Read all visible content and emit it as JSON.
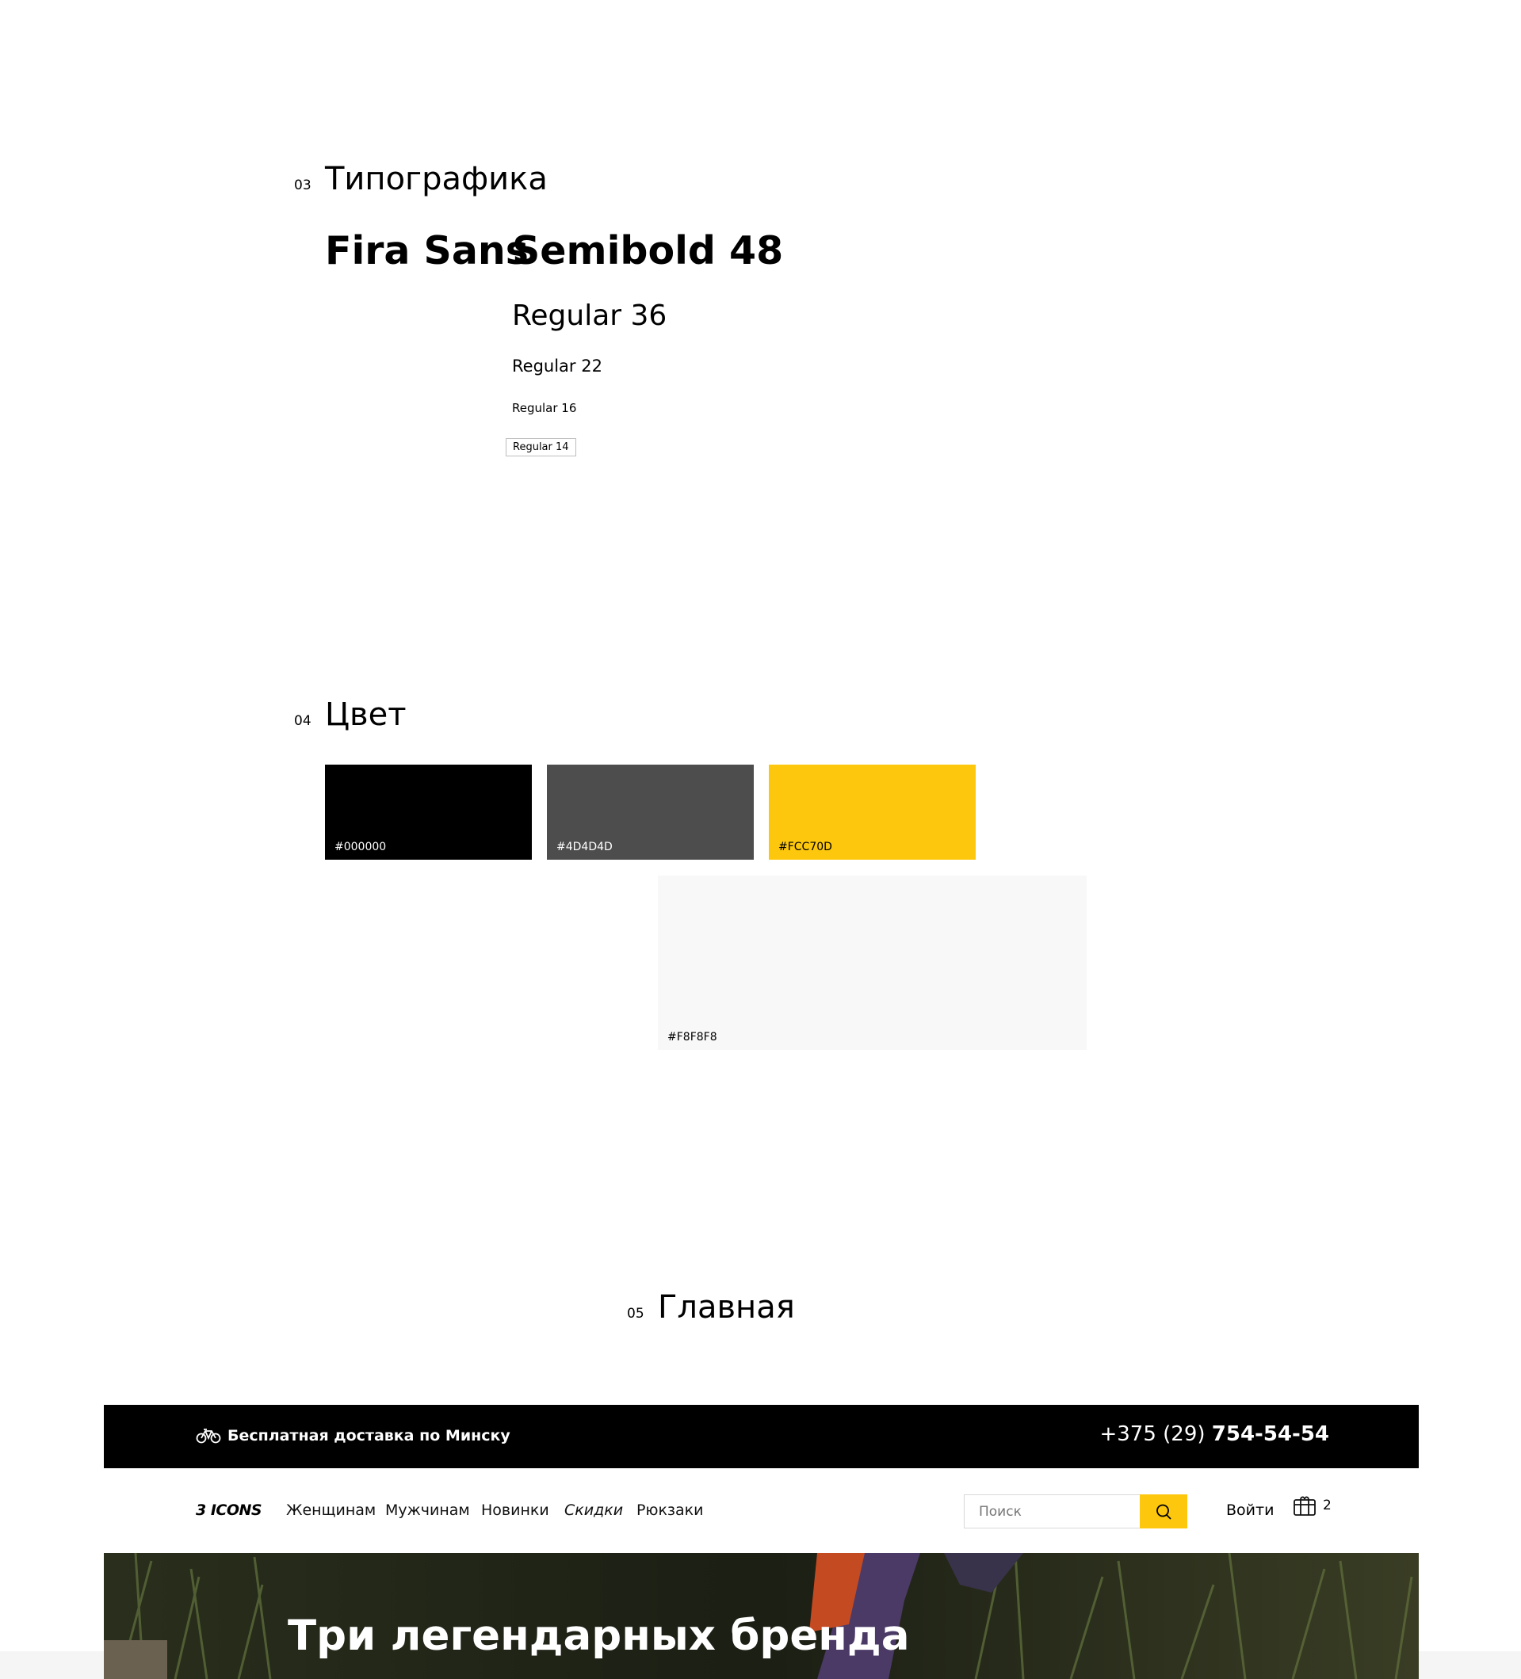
{
  "sections": {
    "typography": {
      "num": "03",
      "title": "Типографика"
    },
    "color": {
      "num": "04",
      "title": "Цвет"
    },
    "main": {
      "num": "05",
      "title": "Главная"
    }
  },
  "typography": {
    "font_name": "Fira Sans",
    "samples": [
      "Semibold 48",
      "Regular 36",
      "Regular 22",
      "Regular 16",
      "Regular 14"
    ]
  },
  "colors": [
    {
      "label": "#000000",
      "hex": "#000000"
    },
    {
      "label": "#4D4D4D",
      "hex": "#4D4D4D"
    },
    {
      "label": "#FCC70D",
      "hex": "#FCC70D"
    },
    {
      "label": "#F8F8F8",
      "hex": "#F8F8F8"
    }
  ],
  "preview": {
    "topbar": {
      "delivery_icon": "bicycle-icon",
      "delivery_text": "Бесплатная доставка по Минску",
      "phone_prefix": "+375 (29) ",
      "phone_number": "754-54-54"
    },
    "nav": {
      "logo": "3 ICONS",
      "items": [
        "Женщинам",
        "Мужчинам",
        "Новинки",
        "Скидки",
        "Рюкзаки"
      ],
      "search_placeholder": "Поиск",
      "search_icon": "search-icon",
      "login": "Войти",
      "cart_icon": "gift-box-icon",
      "cart_count": "2"
    },
    "hero": {
      "title": "Три легендарных бренда"
    }
  }
}
